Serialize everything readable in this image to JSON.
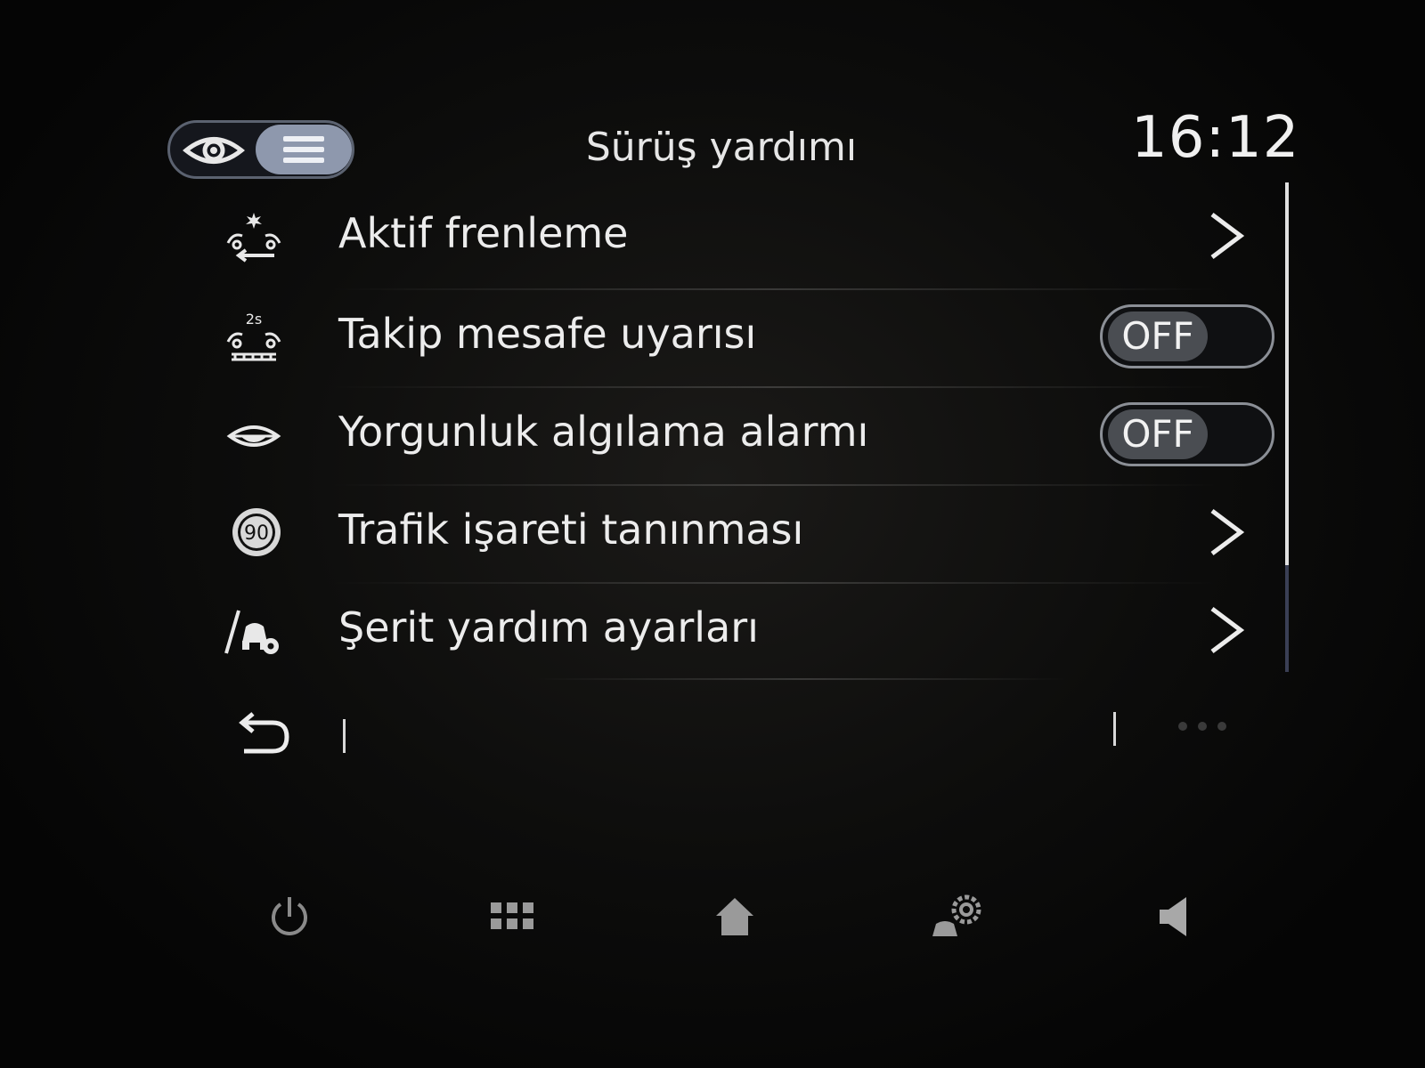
{
  "header": {
    "title": "Sürüş yardımı",
    "clock": "16:12",
    "view_switch": {
      "left_icon": "eye-icon",
      "right_icon": "list-icon",
      "selected": "list"
    }
  },
  "menu": {
    "items": [
      {
        "label": "Aktif frenleme",
        "icon": "active-braking-icon",
        "control": "chevron"
      },
      {
        "label": "Takip mesafe uyarısı",
        "icon": "distance-warning-icon",
        "control": "toggle",
        "state": "OFF"
      },
      {
        "label": "Yorgunluk algılama alarmı",
        "icon": "fatigue-eye-icon",
        "control": "toggle",
        "state": "OFF"
      },
      {
        "label": "Trafik işareti tanınması",
        "icon": "speed-sign-icon",
        "control": "chevron",
        "badge": "90"
      },
      {
        "label": "Şerit yardım ayarları",
        "icon": "lane-assist-icon",
        "control": "chevron"
      }
    ]
  },
  "footer": {
    "back_icon": "back-arrow-icon",
    "more_icon": "more-dots-icon"
  },
  "bottom_bar": {
    "items": [
      {
        "icon": "power-icon"
      },
      {
        "icon": "apps-grid-icon"
      },
      {
        "icon": "home-icon"
      },
      {
        "icon": "car-settings-icon"
      },
      {
        "icon": "speaker-icon"
      }
    ]
  },
  "colors": {
    "accent": "#8e98ad",
    "text": "#ececec",
    "toggle_knob": "#4a4d52"
  }
}
